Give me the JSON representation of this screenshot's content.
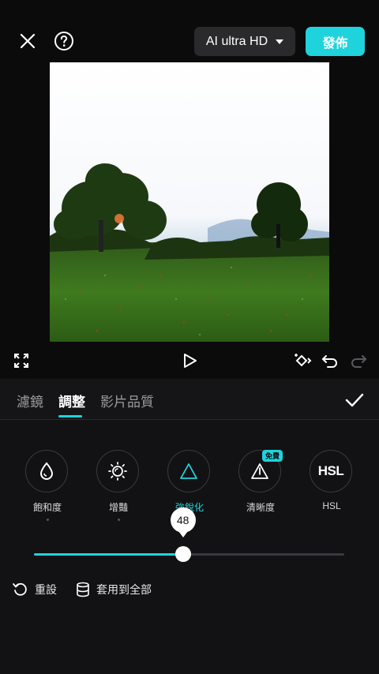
{
  "header": {
    "quality_label": "AI ultra HD",
    "publish_label": "發佈"
  },
  "tabs": [
    {
      "label": "濾鏡",
      "active": false
    },
    {
      "label": "調整",
      "active": true
    },
    {
      "label": "影片品質",
      "active": false
    }
  ],
  "tools": [
    {
      "label": "飽和度",
      "icon": "droplet-icon"
    },
    {
      "label": "增豔",
      "icon": "sun-icon"
    },
    {
      "label": "強銳化",
      "icon": "triangle-icon"
    },
    {
      "label": "清晰度",
      "icon": "warning-triangle-icon",
      "badge": "免費"
    },
    {
      "label": "HSL",
      "icon": "hsl-icon"
    }
  ],
  "slider": {
    "value_label": "48",
    "value": 48,
    "fraction": 0.48
  },
  "actions": {
    "reset_label": "重設",
    "apply_all_label": "套用到全部"
  },
  "colors": {
    "accent": "#1fd3dc",
    "background": "#121214"
  }
}
